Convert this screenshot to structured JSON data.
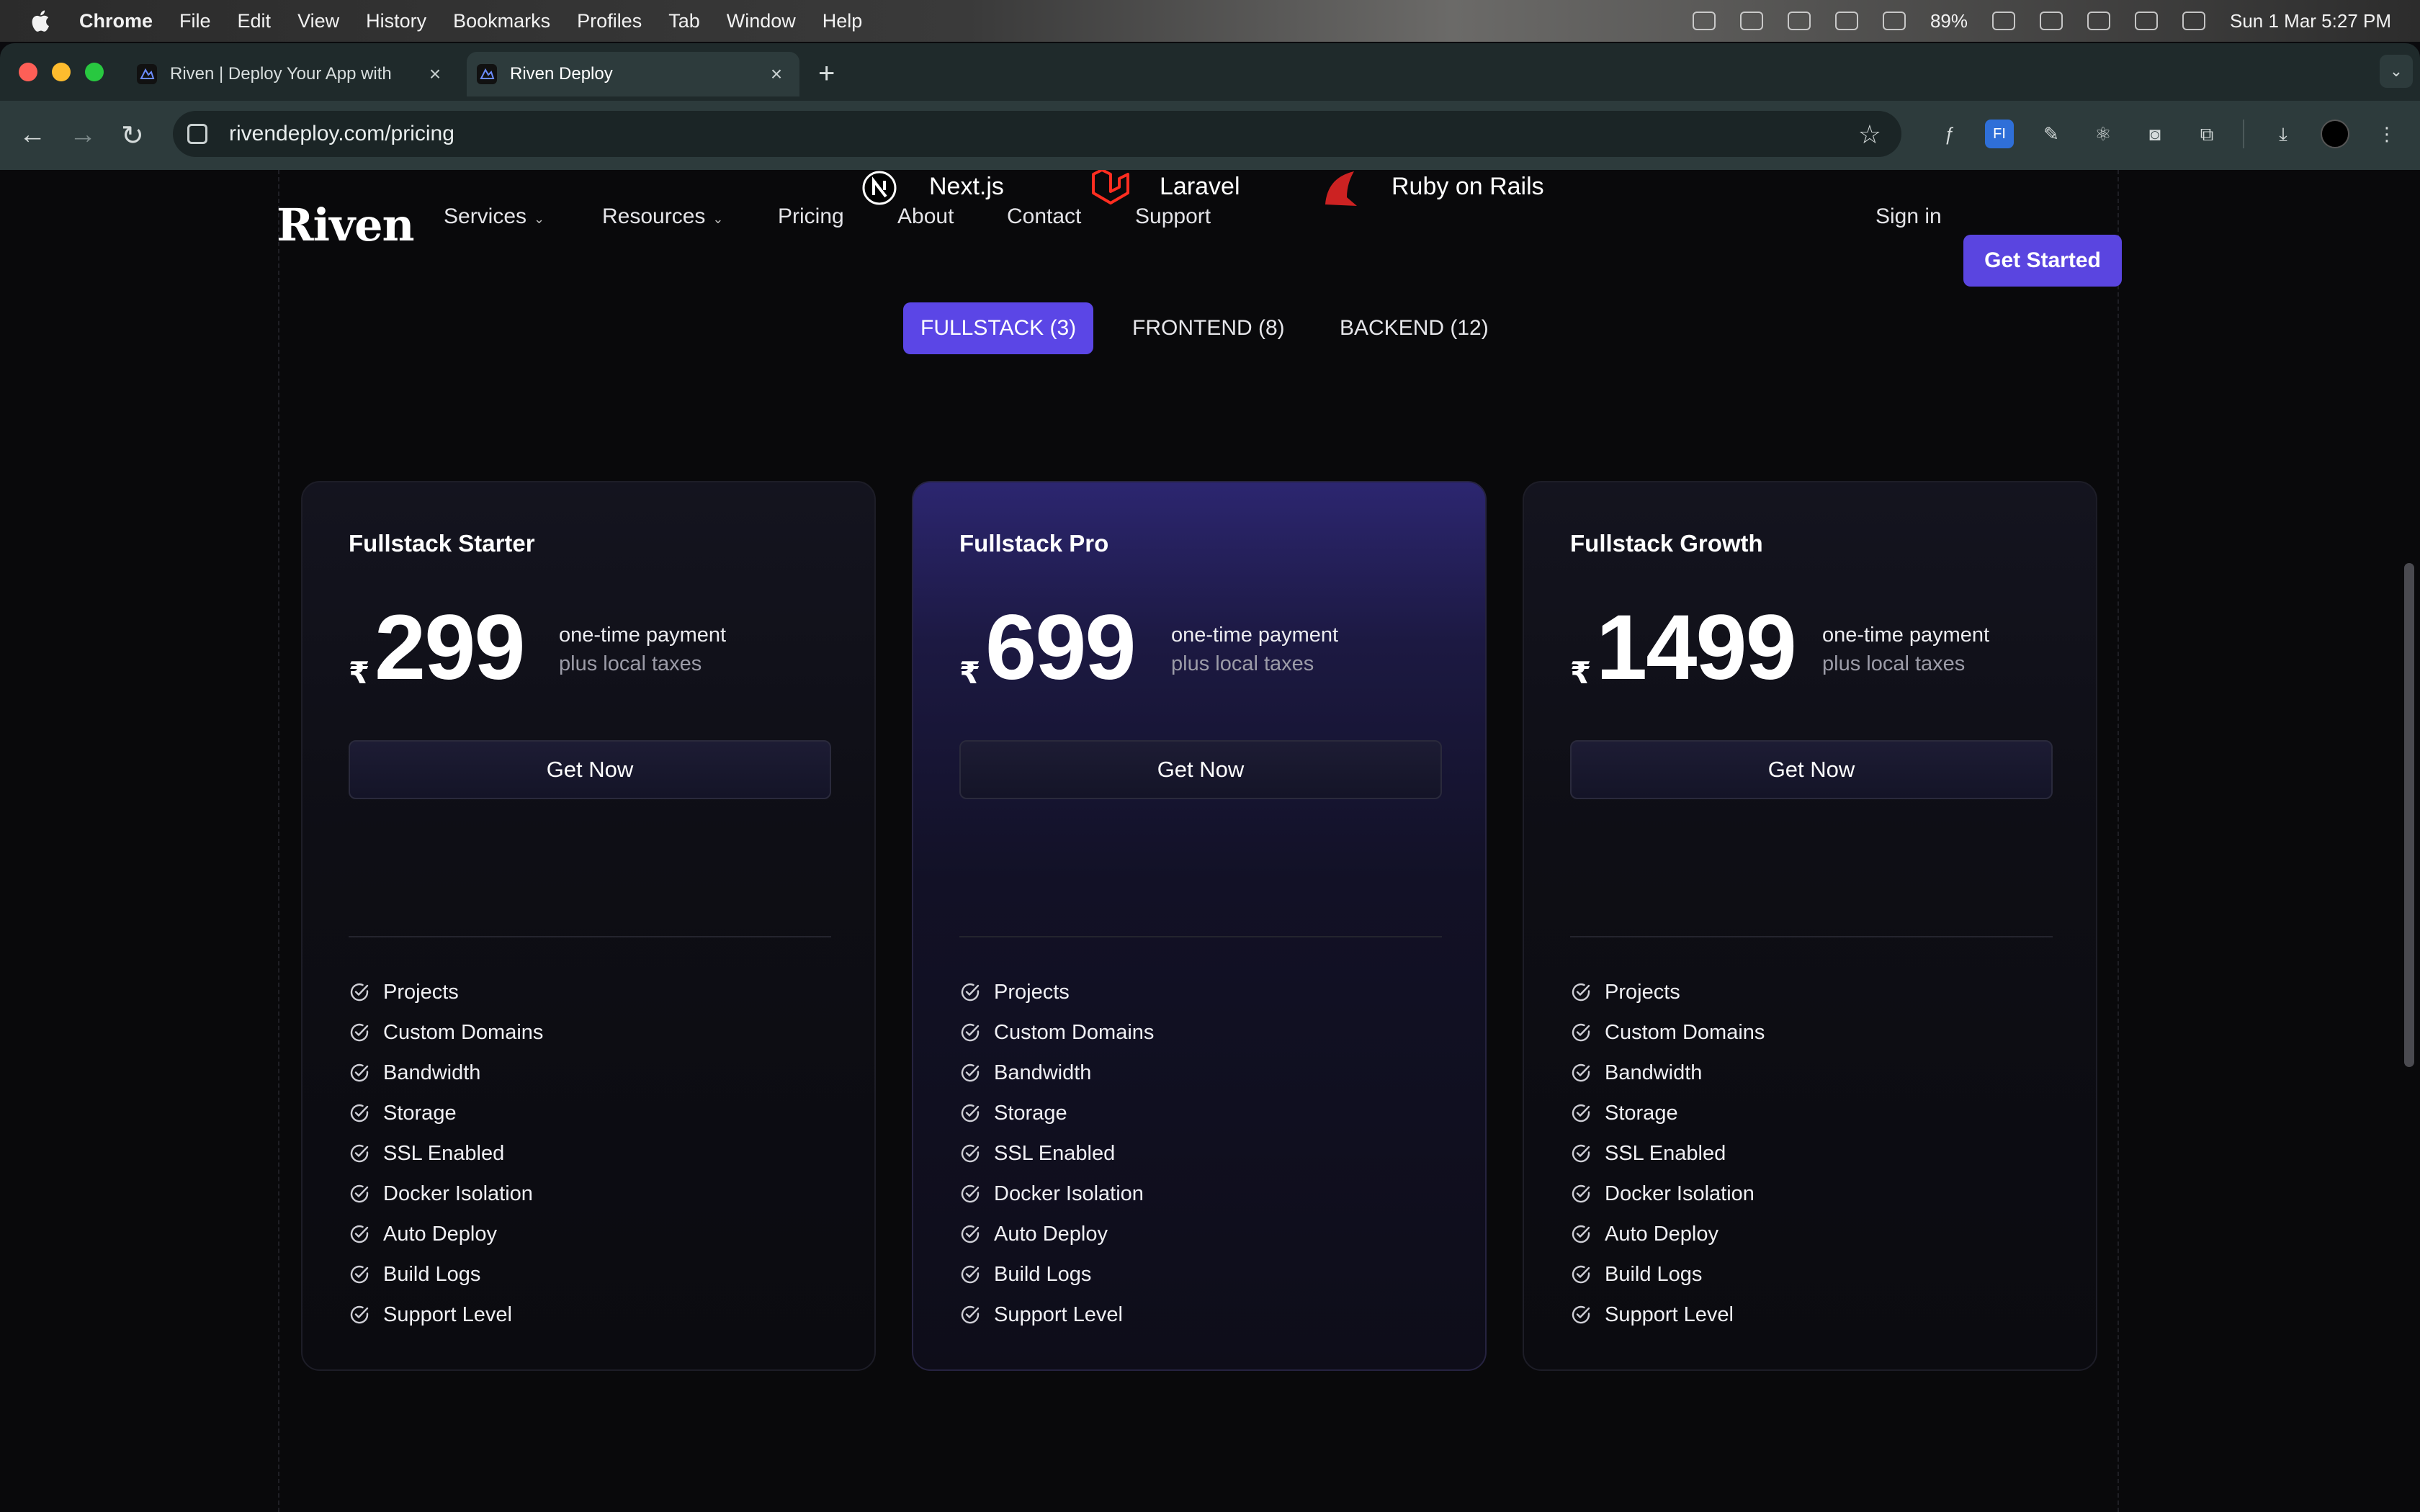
{
  "menubar": {
    "app": "Chrome",
    "items": [
      "File",
      "Edit",
      "View",
      "History",
      "Bookmarks",
      "Profiles",
      "Tab",
      "Window",
      "Help"
    ],
    "battery": "89%",
    "datetime": "Sun 1 Mar  5:27 PM"
  },
  "browser": {
    "tabs": [
      {
        "title": "Riven | Deploy Your App with",
        "active": false
      },
      {
        "title": "Riven Deploy",
        "active": true
      }
    ],
    "new_tab": "+",
    "url": "rivendeploy.com/pricing"
  },
  "site": {
    "logo": "Riven",
    "nav": {
      "services": "Services",
      "resources": "Resources",
      "pricing": "Pricing",
      "about": "About",
      "contact": "Contact",
      "support": "Support"
    },
    "sign_in": "Sign in",
    "get_started": "Get Started",
    "tech": {
      "nextjs": "Next.js",
      "laravel": "Laravel",
      "rails": "Ruby on Rails"
    }
  },
  "filters": {
    "fullstack": "FULLSTACK (3)",
    "frontend": "FRONTEND (8)",
    "backend": "BACKEND (12)"
  },
  "plans": [
    {
      "name": "Fullstack Starter",
      "currency": "₹",
      "price": "299",
      "payment": "one-time payment",
      "taxes": "plus local taxes",
      "cta": "Get Now"
    },
    {
      "name": "Fullstack Pro",
      "currency": "₹",
      "price": "699",
      "payment": "one-time payment",
      "taxes": "plus local taxes",
      "cta": "Get Now"
    },
    {
      "name": "Fullstack Growth",
      "currency": "₹",
      "price": "1499",
      "payment": "one-time payment",
      "taxes": "plus local taxes",
      "cta": "Get Now"
    }
  ],
  "features": [
    "Projects",
    "Custom Domains",
    "Bandwidth",
    "Storage",
    "SSL Enabled",
    "Docker Isolation",
    "Auto Deploy",
    "Build Logs",
    "Support Level"
  ],
  "colors": {
    "accent": "#5b46e6",
    "background": "#09090b",
    "card": "#0e0e15"
  }
}
